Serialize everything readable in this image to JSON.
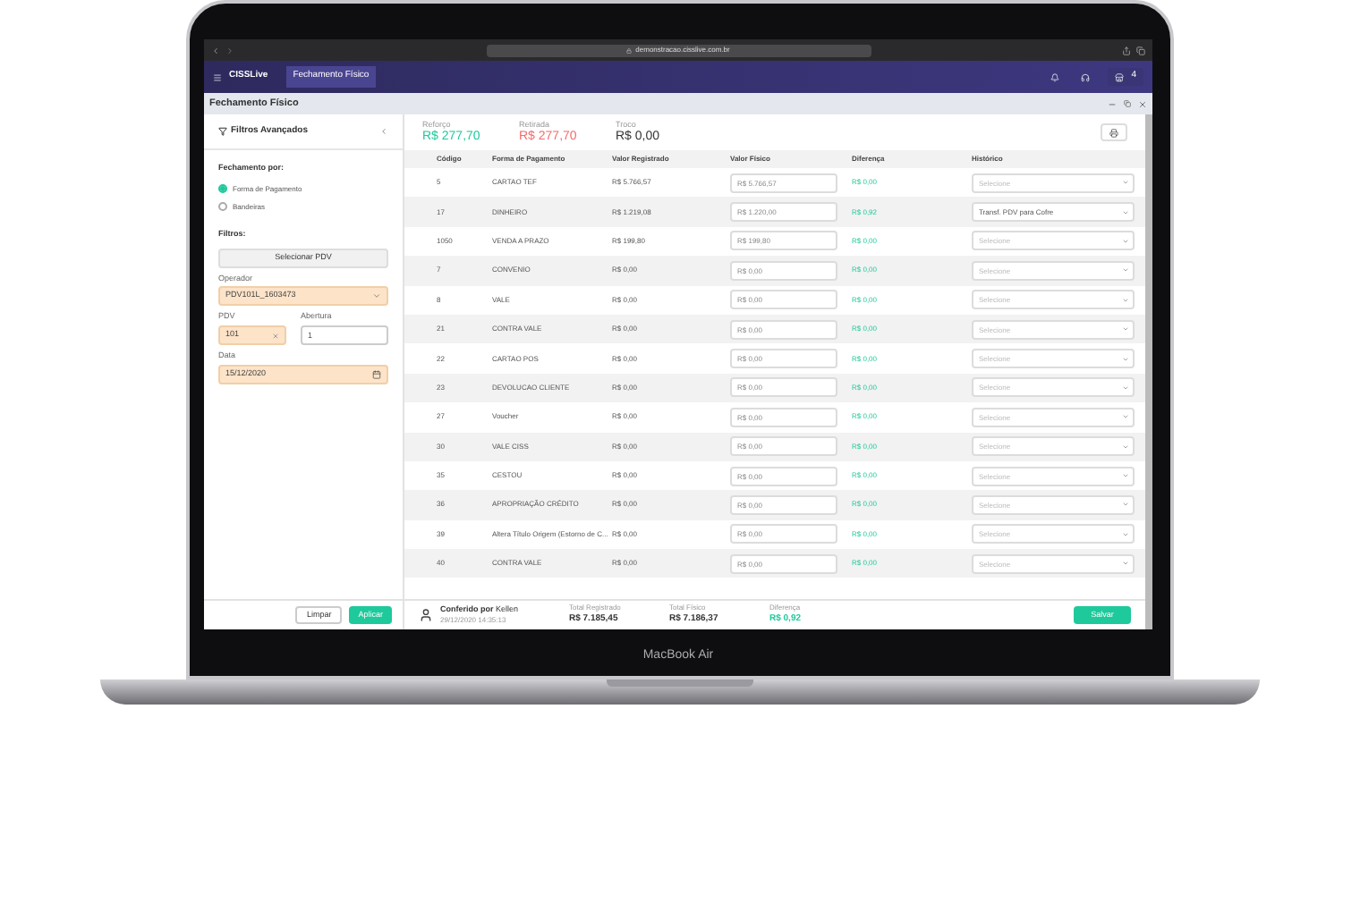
{
  "browser": {
    "url": "demonstracao.cisslive.com.br"
  },
  "app_header": {
    "brand": "CISSLive",
    "tab": "Fechamento Físico",
    "badge": "4"
  },
  "window": {
    "title": "Fechamento Físico"
  },
  "filters": {
    "title": "Filtros Avançados",
    "group_label": "Fechamento por:",
    "options": [
      {
        "label": "Forma de Pagamento",
        "selected": true
      },
      {
        "label": "Bandeiras",
        "selected": false
      }
    ],
    "filters_label": "Filtros:",
    "pdv_button": "Selecionar PDV",
    "operator": {
      "label": "Operador",
      "value": "PDV101L_1603473"
    },
    "pdv": {
      "label": "PDV",
      "value": "101"
    },
    "opening": {
      "label": "Abertura",
      "value": "1"
    },
    "date": {
      "label": "Data",
      "value": "15/12/2020"
    },
    "buttons": [
      {
        "label": "Limpar",
        "kind": "secondary"
      },
      {
        "label": "Aplicar",
        "kind": "primary"
      }
    ]
  },
  "summary": [
    {
      "label": "Reforço",
      "value": "R$ 277,70",
      "color": "#1ec99b"
    },
    {
      "label": "Retirada",
      "value": "R$ 277,70",
      "color": "#f36b6b"
    },
    {
      "label": "Troco",
      "value": "R$ 0,00",
      "color": "#333333"
    }
  ],
  "table": {
    "columns": [
      "Código",
      "Forma de Pagamento",
      "Valor Registrado",
      "Valor Físico",
      "Diferença",
      "Histórico"
    ],
    "rows": [
      {
        "code": "5",
        "method": "CARTAO TEF",
        "registered": "R$ 5.766,57",
        "physical": "R$ 5.766,57",
        "difference": "R$ 0,00",
        "history": {
          "placeholder": "Selecione"
        }
      },
      {
        "code": "17",
        "method": "DINHEIRO",
        "registered": "R$ 1.219,08",
        "physical": "R$ 1.220,00",
        "difference": "R$ 0,92",
        "history": {
          "value": "Transf. PDV para Cofre"
        }
      },
      {
        "code": "1050",
        "method": "VENDA A PRAZO",
        "registered": "R$ 199,80",
        "physical": "R$ 199,80",
        "difference": "R$ 0,00",
        "history": {
          "placeholder": "Selecione"
        }
      },
      {
        "code": "7",
        "method": "CONVENIO",
        "registered": "R$ 0,00",
        "physical": "R$ 0,00",
        "difference": "R$ 0,00",
        "history": {
          "placeholder": "Selecione"
        }
      },
      {
        "code": "8",
        "method": "VALE",
        "registered": "R$ 0,00",
        "physical": "R$ 0,00",
        "difference": "R$ 0,00",
        "history": {
          "placeholder": "Selecione"
        }
      },
      {
        "code": "21",
        "method": "CONTRA VALE",
        "registered": "R$ 0,00",
        "physical": "R$ 0,00",
        "difference": "R$ 0,00",
        "history": {
          "placeholder": "Selecione"
        }
      },
      {
        "code": "22",
        "method": "CARTAO POS",
        "registered": "R$ 0,00",
        "physical": "R$ 0,00",
        "difference": "R$ 0,00",
        "history": {
          "placeholder": "Selecione"
        }
      },
      {
        "code": "23",
        "method": "DEVOLUCAO CLIENTE",
        "registered": "R$ 0,00",
        "physical": "R$ 0,00",
        "difference": "R$ 0,00",
        "history": {
          "placeholder": "Selecione"
        }
      },
      {
        "code": "27",
        "method": "Voucher",
        "registered": "R$ 0,00",
        "physical": "R$ 0,00",
        "difference": "R$ 0,00",
        "history": {
          "placeholder": "Selecione"
        }
      },
      {
        "code": "30",
        "method": "VALE CISS",
        "registered": "R$ 0,00",
        "physical": "R$ 0,00",
        "difference": "R$ 0,00",
        "history": {
          "placeholder": "Selecione"
        }
      },
      {
        "code": "35",
        "method": "CESTOU",
        "registered": "R$ 0,00",
        "physical": "R$ 0,00",
        "difference": "R$ 0,00",
        "history": {
          "placeholder": "Selecione"
        }
      },
      {
        "code": "36",
        "method": "APROPRIAÇÃO CRÉDITO",
        "registered": "R$ 0,00",
        "physical": "R$ 0,00",
        "difference": "R$ 0,00",
        "history": {
          "placeholder": "Selecione"
        }
      },
      {
        "code": "39",
        "method": "Altera Título Origem (Estorno de C...",
        "registered": "R$ 0,00",
        "physical": "R$ 0,00",
        "difference": "R$ 0,00",
        "history": {
          "placeholder": "Selecione"
        }
      },
      {
        "code": "40",
        "method": "CONTRA VALE",
        "registered": "R$ 0,00",
        "physical": "R$ 0,00",
        "difference": "R$ 0,00",
        "history": {
          "placeholder": "Selecione"
        }
      }
    ]
  },
  "footer": {
    "checked_by": "**Conferido por** Kellen",
    "timestamp": "29/12/2020 14:35:13",
    "totals": [
      {
        "label": "Total Registrado",
        "value": "R$ 7.185,45",
        "color": "#333333"
      },
      {
        "label": "Total Físico",
        "value": "R$ 7.186,37",
        "color": "#333333"
      },
      {
        "label": "Diferença",
        "value": "R$ 0,92",
        "color": "#1ec99b"
      }
    ],
    "save": "Salvar"
  },
  "device": {
    "label": "MacBook Air"
  }
}
